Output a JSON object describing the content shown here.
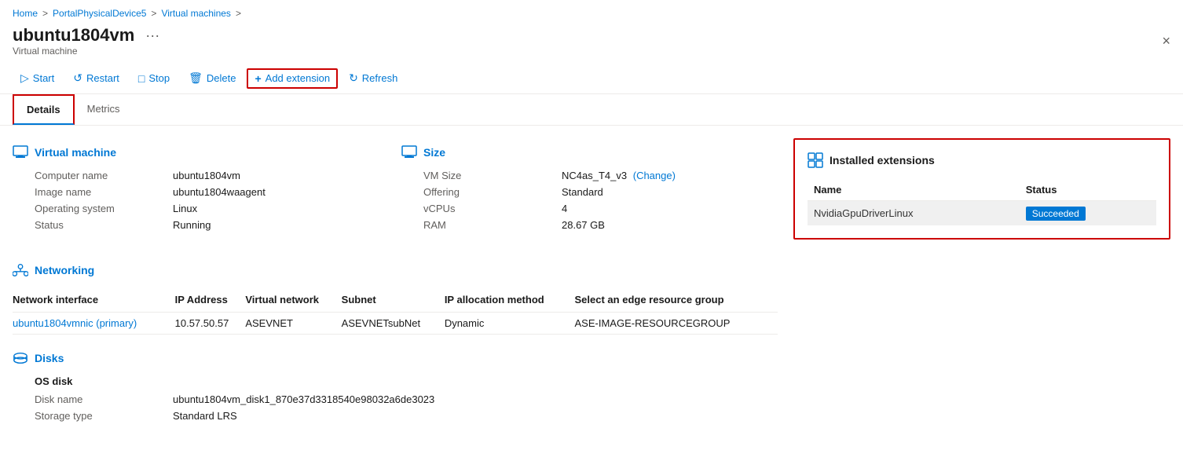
{
  "breadcrumb": {
    "items": [
      {
        "label": "Home",
        "href": "#"
      },
      {
        "label": "PortalPhysicalDevice5",
        "href": "#"
      },
      {
        "label": "Virtual machines",
        "href": "#"
      }
    ],
    "separator": ">"
  },
  "page": {
    "title": "ubuntu1804vm",
    "subtitle": "Virtual machine",
    "close_label": "×"
  },
  "toolbar": {
    "buttons": [
      {
        "id": "start",
        "label": "Start",
        "icon": "▷"
      },
      {
        "id": "restart",
        "label": "Restart",
        "icon": "↺"
      },
      {
        "id": "stop",
        "label": "Stop",
        "icon": "□"
      },
      {
        "id": "delete",
        "label": "Delete",
        "icon": "🗑"
      },
      {
        "id": "add-extension",
        "label": "Add extension",
        "icon": "+"
      },
      {
        "id": "refresh",
        "label": "Refresh",
        "icon": "↻"
      }
    ]
  },
  "tabs": [
    {
      "id": "details",
      "label": "Details",
      "active": true
    },
    {
      "id": "metrics",
      "label": "Metrics",
      "active": false
    }
  ],
  "vm_section": {
    "title": "Virtual machine",
    "fields": [
      {
        "label": "Computer name",
        "value": "ubuntu1804vm"
      },
      {
        "label": "Image name",
        "value": "ubuntu1804waagent"
      },
      {
        "label": "Operating system",
        "value": "Linux"
      },
      {
        "label": "Status",
        "value": "Running"
      }
    ]
  },
  "size_section": {
    "title": "Size",
    "fields": [
      {
        "label": "VM Size",
        "value": "NC4as_T4_v3",
        "has_change": true
      },
      {
        "label": "Offering",
        "value": "Standard"
      },
      {
        "label": "vCPUs",
        "value": "4"
      },
      {
        "label": "RAM",
        "value": "28.67 GB"
      }
    ]
  },
  "networking_section": {
    "title": "Networking",
    "columns": [
      "Network interface",
      "IP Address",
      "Virtual network",
      "Subnet",
      "IP allocation method",
      "Select an edge resource group"
    ],
    "rows": [
      {
        "network_interface": "ubuntu1804vmnic (primary)",
        "ip_address": "10.57.50.57",
        "virtual_network": "ASEVNET",
        "subnet": "ASEVNETsubNet",
        "ip_allocation": "Dynamic",
        "resource_group": "ASE-IMAGE-RESOURCEGROUP"
      }
    ]
  },
  "disks_section": {
    "title": "Disks",
    "os_disk_label": "OS disk",
    "fields": [
      {
        "label": "Disk name",
        "value": "ubuntu1804vm_disk1_870e37d3318540e98032a6de3023"
      },
      {
        "label": "Storage type",
        "value": "Standard LRS"
      }
    ]
  },
  "installed_extensions": {
    "title": "Installed extensions",
    "columns": [
      "Name",
      "Status"
    ],
    "rows": [
      {
        "name": "NvidiaGpuDriverLinux",
        "status": "Succeeded"
      }
    ]
  }
}
